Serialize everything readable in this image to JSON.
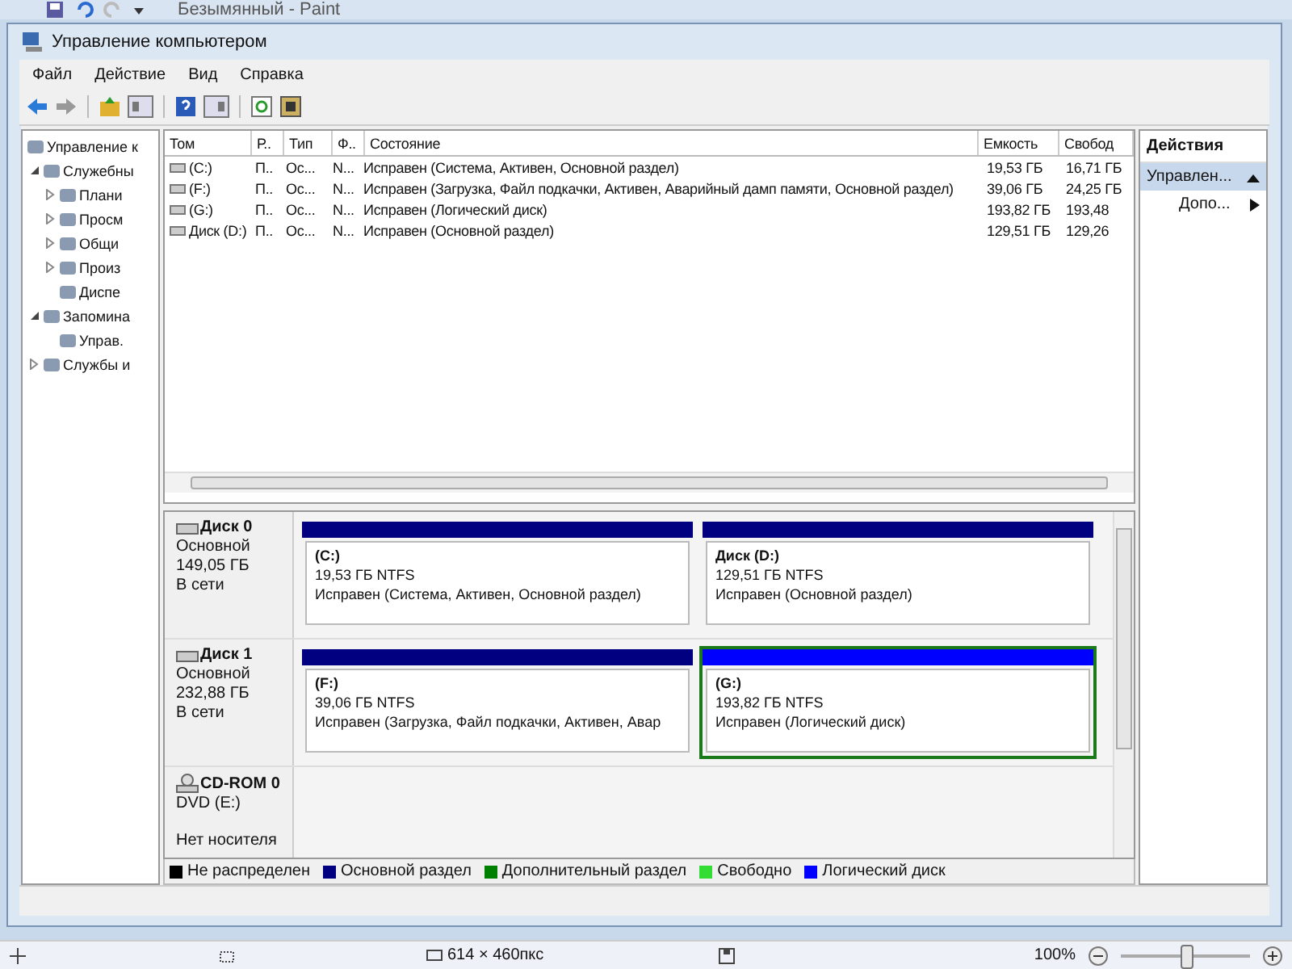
{
  "paint_title": "Безымянный - Paint",
  "window": {
    "title": "Управление компьютером"
  },
  "menu": [
    "Файл",
    "Действие",
    "Вид",
    "Справка"
  ],
  "tree": [
    {
      "label": "Управление к",
      "children": [
        {
          "label": "Служебны",
          "expanded": true,
          "children": [
            {
              "label": "Плани",
              "expanded": false
            },
            {
              "label": "Просм",
              "expanded": false
            },
            {
              "label": "Общи",
              "expanded": false
            },
            {
              "label": "Произ",
              "expanded": false
            },
            {
              "label": "Диспе"
            }
          ]
        },
        {
          "label": "Запомина",
          "expanded": true,
          "children": [
            {
              "label": "Управ."
            }
          ]
        },
        {
          "label": "Службы и",
          "expanded": false
        }
      ]
    }
  ],
  "table": {
    "columns": [
      "Том",
      "Р..",
      "Тип",
      "Ф..",
      "Состояние",
      "Емкость",
      "Свобод"
    ],
    "rows": [
      [
        "(C:)",
        "П..",
        "Ос...",
        "N...",
        "Исправен (Система, Активен, Основной раздел)",
        "19,53 ГБ",
        "16,71 ГБ"
      ],
      [
        "(F:)",
        "П..",
        "Ос...",
        "N...",
        "Исправен (Загрузка, Файл подкачки, Активен, Аварийный дамп памяти, Основной раздел)",
        "39,06 ГБ",
        "24,25 ГБ"
      ],
      [
        "(G:)",
        "П..",
        "Ос...",
        "N...",
        "Исправен (Логический диск)",
        "193,82 ГБ",
        "193,48"
      ],
      [
        "Диск (D:)",
        "П..",
        "Ос...",
        "N...",
        "Исправен (Основной раздел)",
        "129,51 ГБ",
        "129,26"
      ]
    ]
  },
  "disks": [
    {
      "name": "Диск 0",
      "type": "Основной",
      "size": "149,05 ГБ",
      "status": "В сети",
      "kind": "hdd",
      "partitions": [
        {
          "name": "(C:)",
          "size": "19,53 ГБ NTFS",
          "status": "Исправен (Система, Активен, Основной раздел)",
          "kind": "primary",
          "selected": false
        },
        {
          "name": "Диск  (D:)",
          "size": "129,51 ГБ NTFS",
          "status": "Исправен (Основной раздел)",
          "kind": "primary",
          "selected": false
        }
      ]
    },
    {
      "name": "Диск 1",
      "type": "Основной",
      "size": "232,88 ГБ",
      "status": "В сети",
      "kind": "hdd",
      "partitions": [
        {
          "name": "(F:)",
          "size": "39,06 ГБ NTFS",
          "status": "Исправен (Загрузка, Файл подкачки, Активен, Авар",
          "kind": "primary",
          "selected": false
        },
        {
          "name": "(G:)",
          "size": "193,82 ГБ NTFS",
          "status": "Исправен (Логический диск)",
          "kind": "logical",
          "selected": true
        }
      ]
    },
    {
      "name": "CD-ROM 0",
      "type": "DVD (E:)",
      "status": "Нет носителя",
      "kind": "cdrom"
    }
  ],
  "legend": [
    {
      "label": "Не распределен",
      "color": "#000000"
    },
    {
      "label": "Основной раздел",
      "color": "#000080"
    },
    {
      "label": "Дополнительный раздел",
      "color": "#008000"
    },
    {
      "label": "Свободно",
      "color": "#33dd33"
    },
    {
      "label": "Логический диск",
      "color": "#0000ff"
    }
  ],
  "actions": {
    "title": "Действия",
    "items": [
      {
        "label": "Управлен...",
        "selected": true,
        "kind": "group"
      },
      {
        "label": "Допо...",
        "selected": false,
        "kind": "submenu"
      }
    ]
  },
  "paint_status": {
    "dimensions": "614 × 460пкс",
    "zoom": "100%",
    "level": 0.5
  }
}
